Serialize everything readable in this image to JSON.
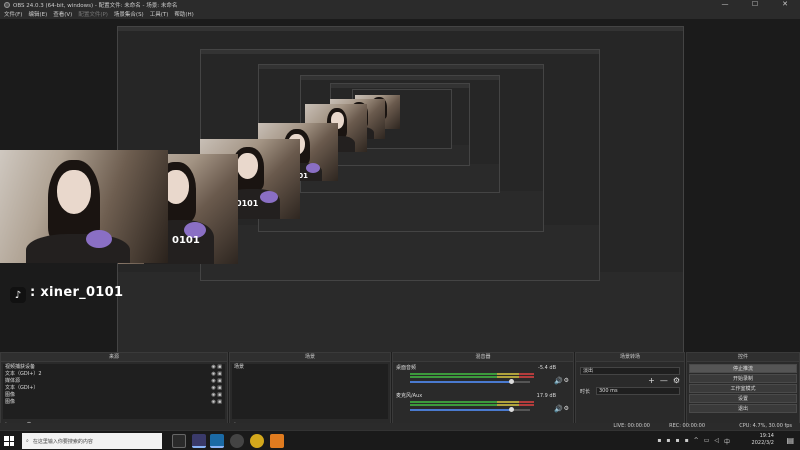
{
  "window": {
    "title": "OBS 24.0.3 (64-bit, windows) - 配置文件: 未命名 - 场景: 未命名",
    "minimize": "—",
    "maximize": "☐",
    "close": "✕"
  },
  "menu": [
    "文件(F)",
    "编辑(E)",
    "查看(V)",
    "配置文件(P)",
    "场景集合(S)",
    "工具(T)",
    "帮助(H)"
  ],
  "overlay": {
    "tiktok_glyph": "♪",
    "username": ": xiner_0101",
    "nested_labels": [
      "_0101",
      "0101",
      "0101"
    ]
  },
  "docks": {
    "sources": {
      "title": "来源",
      "items": [
        "视频捕获设备",
        "文本（GDI+）2",
        "媒体源",
        "文本（GDI+）",
        "图像",
        "图像"
      ],
      "tools": [
        "+",
        "—",
        "⚙",
        "∧",
        "∨"
      ]
    },
    "scenes": {
      "title": "场景",
      "items": [
        "场景"
      ],
      "tools": [
        "+",
        "—",
        "∧",
        "∨"
      ]
    },
    "mixer": {
      "title": "混音器",
      "channels": [
        {
          "name": "桌面音频",
          "db": "-5.4 dB",
          "level": 0.84
        },
        {
          "name": "麦克风/Aux",
          "db": "17.9 dB",
          "level": 0.84
        }
      ]
    },
    "transitions": {
      "title": "场景转场",
      "selected": "淡出",
      "duration_label": "时长",
      "duration_value": "300 ms"
    },
    "controls": {
      "title": "控件",
      "buttons": [
        "停止推流",
        "开始录制",
        "工作室模式",
        "设置",
        "退出"
      ]
    }
  },
  "status": {
    "live": "LIVE: 00:00:00",
    "rec": "REC: 00:00:00",
    "cpu": "CPU: 4.7%, 30.00 fps"
  },
  "taskbar": {
    "search_placeholder": "在这里输入你要搜索的内容",
    "time": "19:14",
    "date": "2022/3/2"
  }
}
